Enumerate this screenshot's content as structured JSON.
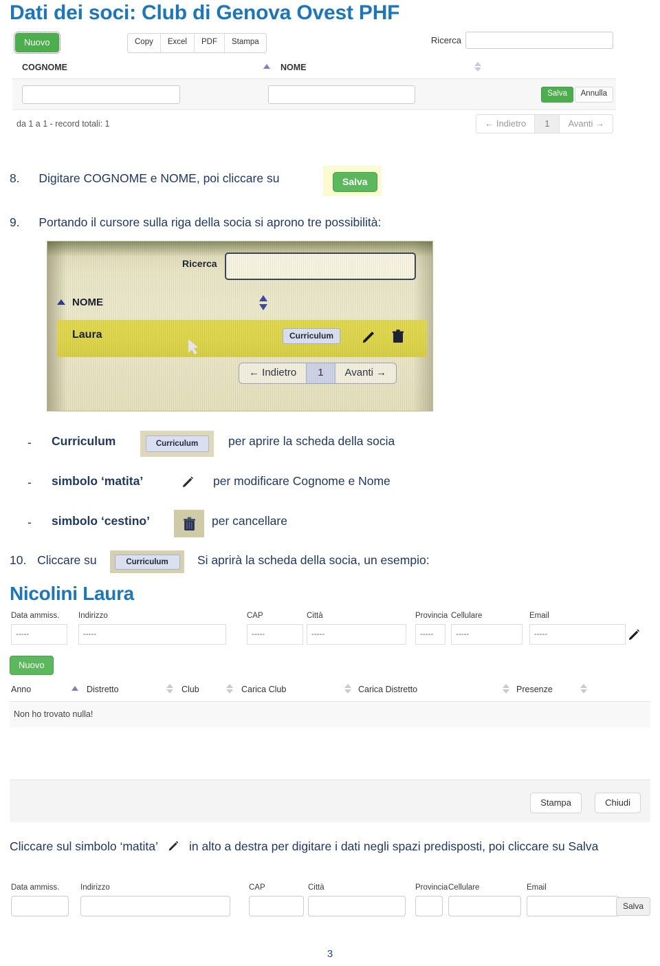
{
  "document": {
    "title": "Dati dei soci: Club di Genova Ovest PHF",
    "page_number": "3",
    "accent_blue": "#1b76bc",
    "text_blue": "#1f3864",
    "green": "#5cb85c",
    "highlight_yellow": "#fbfbd2",
    "row_highlight": "#dcd54a"
  },
  "top_panel": {
    "new_button": "Nuovo",
    "export_buttons": [
      "Copy",
      "Excel",
      "PDF",
      "Stampa"
    ],
    "search_label": "Ricerca",
    "search_value": "",
    "search_placeholder": "",
    "columns": [
      {
        "label": "COGNOME",
        "sort": "asc"
      },
      {
        "label": "NOME",
        "sort": "both"
      }
    ],
    "entry_row": {
      "cognome_value": "",
      "nome_value": "",
      "save_label": "Salva",
      "cancel_label": "Annulla"
    },
    "record_info": "da 1 a 1 - record totali: 1",
    "pager": {
      "prev": "← Indietro",
      "current": "1",
      "next": "Avanti →"
    }
  },
  "steps": {
    "step8": {
      "number": "8.",
      "text": "Digitare COGNOME e NOME, poi cliccare su",
      "button_label": "Salva"
    },
    "step9": {
      "number": "9.",
      "text": "Portando il cursore sulla riga della socia si aprono tre possibilità:"
    },
    "step10": {
      "number": "10.",
      "text_before": "Cliccare su",
      "button_label": "Curriculum",
      "text_after": "Si aprirà la scheda della socia, un esempio:"
    }
  },
  "photo_panel": {
    "search_label": "Ricerca",
    "search_value": "",
    "column_label": "NOME",
    "row_value": "Laura",
    "curriculum_button": "Curriculum",
    "pencil_icon": "pencil-icon",
    "trash_icon": "trash-icon",
    "cursor_icon": "mouse-cursor",
    "pager": {
      "prev": "← Indietro",
      "current": "1",
      "next": "Avanti →"
    }
  },
  "options": [
    {
      "dash": "-",
      "name": "Curriculum",
      "thumb_type": "curriculum-button",
      "thumb_label": "Curriculum",
      "description": "per aprire la scheda della socia"
    },
    {
      "dash": "-",
      "name": "simbolo ‘matita’",
      "thumb_type": "pencil-icon",
      "thumb_label": "",
      "description": "per modificare Cognome e Nome"
    },
    {
      "dash": "-",
      "name": "simbolo ‘cestino’",
      "thumb_type": "trash-icon",
      "thumb_label": "",
      "description": "per cancellare"
    }
  ],
  "scheda": {
    "member_name": "Nicolini Laura",
    "fields": [
      {
        "label": "Data ammiss.",
        "value": "-----"
      },
      {
        "label": "Indirizzo",
        "value": "-----"
      },
      {
        "label": "CAP",
        "value": "-----"
      },
      {
        "label": "Città",
        "value": "-----"
      },
      {
        "label": "Provincia",
        "value": "-----"
      },
      {
        "label": "Cellulare",
        "value": "-----"
      },
      {
        "label": "Email",
        "value": "-----"
      }
    ],
    "edit_icon": "pencil-icon",
    "new_button": "Nuovo",
    "table_columns": [
      {
        "label": "Anno",
        "sort": "asc"
      },
      {
        "label": "Distretto",
        "sort": "both"
      },
      {
        "label": "Club",
        "sort": "both"
      },
      {
        "label": "Carica Club",
        "sort": "both"
      },
      {
        "label": "Carica Distretto",
        "sort": "both"
      },
      {
        "label": "Presenze",
        "sort": "both"
      }
    ],
    "empty_message": "Non ho trovato nulla!",
    "print_button": "Stampa",
    "close_button": "Chiudi"
  },
  "closing_note": {
    "text_before": "Cliccare sul simbolo ‘matita’",
    "pencil_icon": "pencil-icon",
    "text_after": "in alto a destra per digitare i dati negli spazi predisposti, poi cliccare su Salva"
  },
  "edit_strip": {
    "fields": [
      {
        "label": "Data ammiss.",
        "value": "",
        "placeholder": ""
      },
      {
        "label": "Indirizzo",
        "value": "",
        "placeholder": ""
      },
      {
        "label": "CAP",
        "value": "",
        "placeholder": ""
      },
      {
        "label": "Città",
        "value": "",
        "placeholder": ""
      },
      {
        "label": "Provincia",
        "value": "",
        "placeholder": ""
      },
      {
        "label": "Cellulare",
        "value": "",
        "placeholder": ""
      },
      {
        "label": "Email",
        "value": "",
        "placeholder": ""
      }
    ],
    "save_button": "Salva"
  }
}
